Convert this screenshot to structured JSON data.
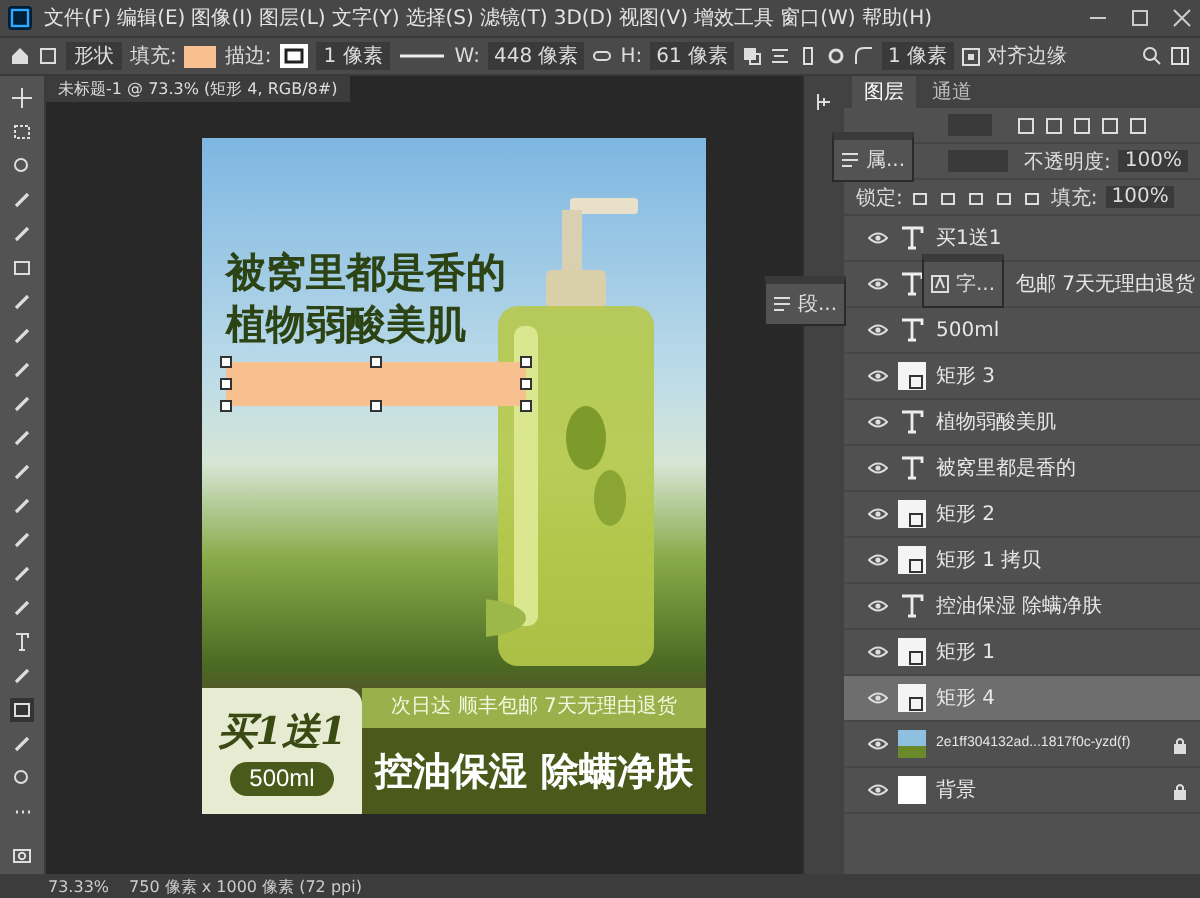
{
  "menu": [
    "文件(F)",
    "编辑(E)",
    "图像(I)",
    "图层(L)",
    "文字(Y)",
    "选择(S)",
    "滤镜(T)",
    "3D(D)",
    "视图(V)",
    "增效工具",
    "窗口(W)",
    "帮助(H)"
  ],
  "options": {
    "tool_mode": "形状",
    "fill_label": "填充:",
    "stroke_label": "描边:",
    "stroke_width": "1 像素",
    "w_label": "W:",
    "w_value": "448 像素",
    "h_label": "H:",
    "h_value": "61 像素",
    "radius": "1 像素",
    "align_edges": {
      "label": "对齐边缘",
      "checked": true
    }
  },
  "document": {
    "tab": "未标题-1 @ 73.3% (矩形 4, RGB/8#)"
  },
  "poster": {
    "headline": [
      "被窝里都是香的",
      "植物弱酸美肌"
    ],
    "offer": "买1送1",
    "volume": "500ml",
    "shipping": "次日达 顺丰包邮 7天无理由退货",
    "benefits": "控油保湿 除螨净肤"
  },
  "layers_panel": {
    "tabs": [
      {
        "label": "图层",
        "selected": true
      },
      {
        "label": "通道",
        "selected": false
      }
    ],
    "opacity_label": "不透明度:",
    "opacity": "100%",
    "lock_label": "锁定:",
    "fill_label": "填充:",
    "fill": "100%",
    "layers": [
      {
        "kind": "text",
        "name": "买1送1",
        "visible": true,
        "selected": false,
        "locked": false
      },
      {
        "kind": "text",
        "name": "包邮 7天无理由退货",
        "visible": true,
        "selected": false,
        "locked": false
      },
      {
        "kind": "text",
        "name": "500ml",
        "visible": true,
        "selected": false,
        "locked": false
      },
      {
        "kind": "shape",
        "name": "矩形 3",
        "visible": true,
        "selected": false,
        "locked": false
      },
      {
        "kind": "text",
        "name": "植物弱酸美肌",
        "visible": true,
        "selected": false,
        "locked": false
      },
      {
        "kind": "text",
        "name": "被窝里都是香的",
        "visible": true,
        "selected": false,
        "locked": false
      },
      {
        "kind": "shape",
        "name": "矩形 2",
        "visible": true,
        "selected": false,
        "locked": false
      },
      {
        "kind": "shape",
        "name": "矩形 1 拷贝",
        "visible": true,
        "selected": false,
        "locked": false
      },
      {
        "kind": "text",
        "name": "控油保湿 除螨净肤",
        "visible": true,
        "selected": false,
        "locked": false
      },
      {
        "kind": "shape",
        "name": "矩形 1",
        "visible": true,
        "selected": false,
        "locked": false
      },
      {
        "kind": "shape",
        "name": "矩形 4",
        "visible": true,
        "selected": true,
        "locked": false
      },
      {
        "kind": "image",
        "name": "2e1ff304132ad...1817f0c-yzd(f)",
        "visible": true,
        "selected": false,
        "locked": true
      },
      {
        "kind": "fill",
        "name": "背景",
        "visible": true,
        "selected": false,
        "locked": true
      }
    ]
  },
  "floating_panels": [
    {
      "kind": "properties",
      "label": "属..."
    },
    {
      "kind": "paragraph",
      "label": "段..."
    },
    {
      "kind": "character",
      "label": "字..."
    }
  ],
  "status": {
    "zoom": "73.33%",
    "doc_size": "750 像素 x 1000 像素 (72 ppi)"
  }
}
